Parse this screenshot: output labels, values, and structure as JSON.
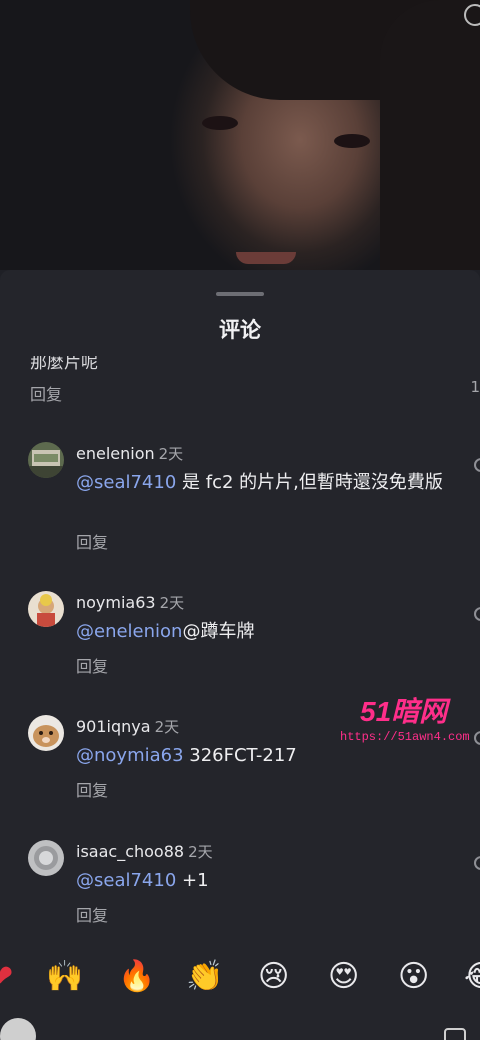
{
  "sheet": {
    "title": "评论"
  },
  "previous_comment": {
    "text_fragment": "那麼片呢",
    "reply_label": "回复",
    "like_count": "1"
  },
  "comments": [
    {
      "username": "enelenion",
      "time": "2天",
      "mention": "@seal7410",
      "text": " 是 fc2 的片片,但暫時還沒免費版",
      "reply_label": "回复"
    },
    {
      "username": "noymia63",
      "time": "2天",
      "mention": "@enelenion",
      "text": "@蹲车牌",
      "reply_label": "回复"
    },
    {
      "username": "901iqnya",
      "time": "2天",
      "mention": "@noymia63",
      "text": " 326FCT-217",
      "reply_label": "回复"
    },
    {
      "username": "isaac_choo88",
      "time": "2天",
      "mention": "@seal7410",
      "text": " +1",
      "reply_label": "回复"
    }
  ],
  "emoji_bar": [
    "❤",
    "🙌",
    "🔥",
    "👏",
    "😢",
    "😍",
    "😮",
    "😂"
  ],
  "watermark": {
    "logo": "51暗网",
    "url": "https://51awn4.com"
  },
  "colors": {
    "background": "#24252b",
    "mention": "#8aa6ec",
    "watermark": "#ff2e8a"
  }
}
